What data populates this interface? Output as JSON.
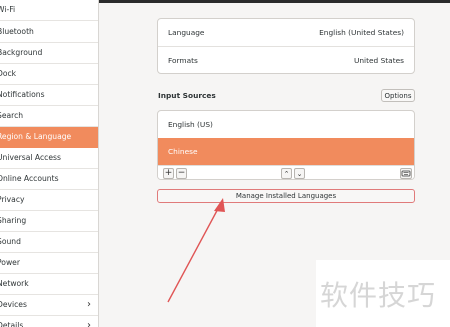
{
  "sidebar": {
    "items": [
      {
        "label": "Wi-Fi",
        "active": false,
        "chevron": false
      },
      {
        "label": "Bluetooth",
        "active": false,
        "chevron": false
      },
      {
        "label": "Background",
        "active": false,
        "chevron": false
      },
      {
        "label": "Dock",
        "active": false,
        "chevron": false
      },
      {
        "label": "Notifications",
        "active": false,
        "chevron": false
      },
      {
        "label": "Search",
        "active": false,
        "chevron": false
      },
      {
        "label": "Region & Language",
        "active": true,
        "chevron": false
      },
      {
        "label": "Universal Access",
        "active": false,
        "chevron": false
      },
      {
        "label": "Online Accounts",
        "active": false,
        "chevron": false
      },
      {
        "label": "Privacy",
        "active": false,
        "chevron": false
      },
      {
        "label": "Sharing",
        "active": false,
        "chevron": false
      },
      {
        "label": "Sound",
        "active": false,
        "chevron": false
      },
      {
        "label": "Power",
        "active": false,
        "chevron": false
      },
      {
        "label": "Network",
        "active": false,
        "chevron": false
      },
      {
        "label": "Devices",
        "active": false,
        "chevron": true
      },
      {
        "label": "Details",
        "active": false,
        "chevron": true
      }
    ]
  },
  "region": {
    "language_label": "Language",
    "language_value": "English (United States)",
    "formats_label": "Formats",
    "formats_value": "United States"
  },
  "input_sources": {
    "title": "Input Sources",
    "options_label": "Options",
    "items": [
      {
        "label": "English (US)",
        "selected": false
      },
      {
        "label": "Chinese",
        "selected": true
      }
    ]
  },
  "manage_label": "Manage Installed Languages",
  "watermark_text": "软件技巧",
  "colors": {
    "accent": "#f18b5d",
    "annotation_arrow": "#e05555"
  }
}
